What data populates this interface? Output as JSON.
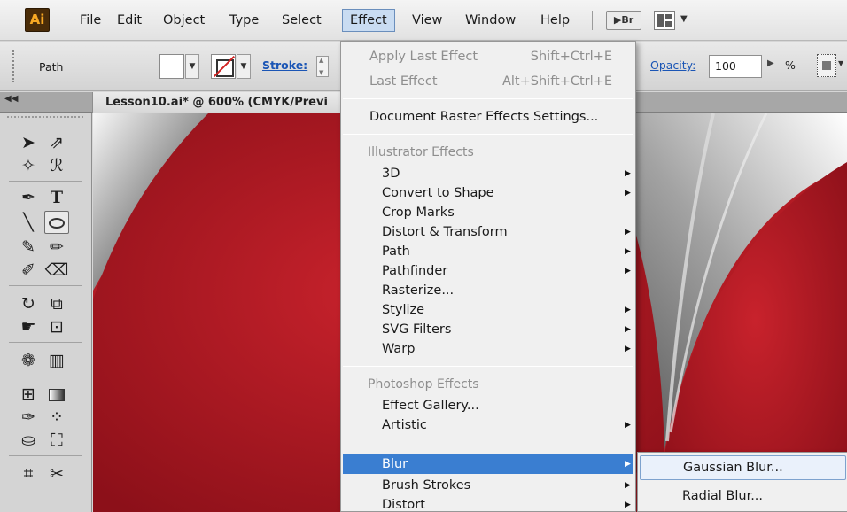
{
  "app": {
    "logo_text": "Ai"
  },
  "menubar": {
    "items": [
      "File",
      "Edit",
      "Object",
      "Type",
      "Select",
      "Effect",
      "View",
      "Window",
      "Help"
    ],
    "bridge_label": "Br",
    "active": "Effect"
  },
  "control_panel": {
    "selection_label": "Path",
    "stroke_label": "Stroke:",
    "opacity_label": "Opacity:",
    "opacity_value": "100",
    "percent_label": "%"
  },
  "document": {
    "tab_title": "Lesson10.ai* @ 600% (CMYK/Previ"
  },
  "colors": {
    "canvas_red": "#b41a23",
    "menu_highlight": "#3a7ed1",
    "submenu_hover": "#eaf1fb"
  },
  "effect_menu": {
    "apply_last": {
      "label": "Apply Last Effect",
      "shortcut": "Shift+Ctrl+E"
    },
    "last": {
      "label": "Last Effect",
      "shortcut": "Alt+Shift+Ctrl+E"
    },
    "raster_settings": "Document Raster Effects Settings...",
    "illustrator_header": "Illustrator Effects",
    "illustrator_items": [
      {
        "label": "3D",
        "submenu": true
      },
      {
        "label": "Convert to Shape",
        "submenu": true
      },
      {
        "label": "Crop Marks",
        "submenu": false
      },
      {
        "label": "Distort & Transform",
        "submenu": true
      },
      {
        "label": "Path",
        "submenu": true
      },
      {
        "label": "Pathfinder",
        "submenu": true
      },
      {
        "label": "Rasterize...",
        "submenu": false
      },
      {
        "label": "Stylize",
        "submenu": true
      },
      {
        "label": "SVG Filters",
        "submenu": true
      },
      {
        "label": "Warp",
        "submenu": true
      }
    ],
    "photoshop_header": "Photoshop Effects",
    "photoshop_items": [
      {
        "label": "Effect Gallery...",
        "submenu": false
      },
      {
        "label": "Artistic",
        "submenu": true
      },
      {
        "label": "Blur",
        "submenu": true,
        "highlighted": true
      },
      {
        "label": "Brush Strokes",
        "submenu": true
      },
      {
        "label": "Distort",
        "submenu": true
      }
    ]
  },
  "blur_submenu": {
    "items": [
      "Gaussian Blur...",
      "Radial Blur..."
    ],
    "hovered": "Gaussian Blur..."
  }
}
